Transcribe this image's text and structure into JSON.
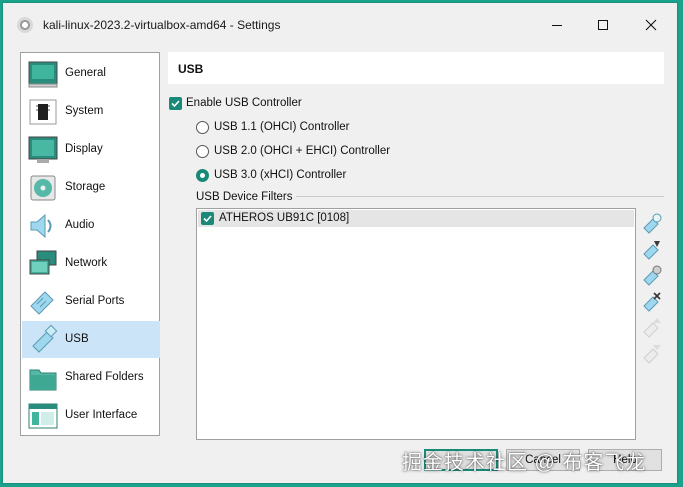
{
  "window": {
    "title": "kali-linux-2023.2-virtualbox-amd64 - Settings",
    "accent_color": "#1a8a78",
    "desktop_color": "#1aa38c"
  },
  "sidebar": {
    "items": [
      {
        "label": "General",
        "icon": "general-icon"
      },
      {
        "label": "System",
        "icon": "system-icon"
      },
      {
        "label": "Display",
        "icon": "display-icon"
      },
      {
        "label": "Storage",
        "icon": "storage-icon"
      },
      {
        "label": "Audio",
        "icon": "audio-icon"
      },
      {
        "label": "Network",
        "icon": "network-icon"
      },
      {
        "label": "Serial Ports",
        "icon": "serial-ports-icon"
      },
      {
        "label": "USB",
        "icon": "usb-icon",
        "selected": true
      },
      {
        "label": "Shared Folders",
        "icon": "shared-folders-icon"
      },
      {
        "label": "User Interface",
        "icon": "user-interface-icon"
      }
    ]
  },
  "usb": {
    "header": "USB",
    "enable_label": "Enable USB Controller",
    "enable_checked": true,
    "controllers": [
      {
        "label": "USB 1.1 (OHCI) Controller",
        "selected": false
      },
      {
        "label": "USB 2.0 (OHCI + EHCI) Controller",
        "selected": false
      },
      {
        "label": "USB 3.0 (xHCI) Controller",
        "selected": true
      }
    ],
    "filters_label": "USB Device Filters",
    "filters": [
      {
        "label": "ATHEROS UB91C [0108]",
        "checked": true
      }
    ]
  },
  "footer": {
    "ok_label": "",
    "cancel_label": "Cancel",
    "help_label": "Help"
  },
  "watermark": "掘金技术社区 @ 布客飞龙"
}
